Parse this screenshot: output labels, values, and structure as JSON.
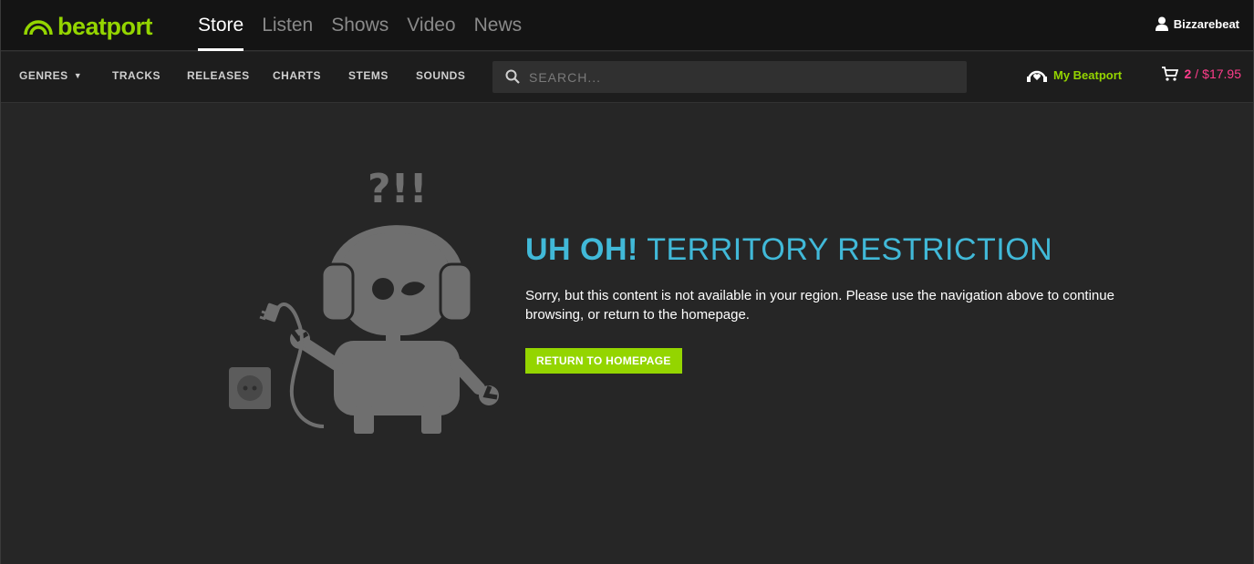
{
  "brand": {
    "name": "beatport",
    "color": "#94d500"
  },
  "top_nav": [
    {
      "label": "Store",
      "active": true
    },
    {
      "label": "Listen",
      "active": false
    },
    {
      "label": "Shows",
      "active": false
    },
    {
      "label": "Video",
      "active": false
    },
    {
      "label": "News",
      "active": false
    }
  ],
  "user": {
    "name": "Bizzarebeat",
    "icon": "user-icon"
  },
  "sub_nav": {
    "genres": "GENRES",
    "tracks": "TRACKS",
    "releases": "RELEASES",
    "charts": "CHARTS",
    "stems": "STEMS",
    "sounds": "SOUNDS"
  },
  "search": {
    "placeholder": "SEARCH..."
  },
  "my_beatport": {
    "label": "My Beatport",
    "icon": "heart-headphones-icon"
  },
  "cart": {
    "count": "2",
    "separator": "/",
    "total": "$17.95",
    "color": "#ff3d8b",
    "icon": "cart-icon"
  },
  "error": {
    "heading_strong": "UH OH!",
    "heading_light": "TERRITORY RESTRICTION",
    "message": "Sorry, but this content is not available in your region. Please use the navigation above to continue browsing, or return to the homepage.",
    "button": "RETURN TO HOMEPAGE",
    "accent": "#41b9d8"
  },
  "illustration": {
    "symbols": "?!!",
    "icon": "robot-headphones-illustration"
  }
}
